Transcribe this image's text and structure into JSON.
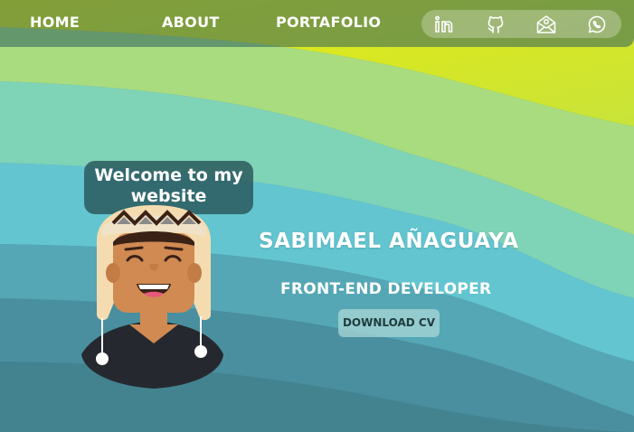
{
  "nav": {
    "links": [
      "HOME",
      "ABOUT",
      "PORTAFOLIO"
    ]
  },
  "social": {
    "icons": [
      "linkedin-icon",
      "github-icon",
      "email-icon",
      "whatsapp-icon"
    ]
  },
  "hero": {
    "greeting": "Welcome to my website",
    "name": "SABIMAEL AÑAGUAYA",
    "role": "FRONT-END DEVELOPER",
    "download_label": "DOWNLOAD CV"
  },
  "colors": {
    "navbar": "#2d5f5f",
    "wave_yellow": "#e6ea0a",
    "wave_green": "#a8dc7c",
    "wave_teal": "#66c7cf",
    "wave_dark": "#4c8d9d",
    "text": "#ffffff"
  }
}
